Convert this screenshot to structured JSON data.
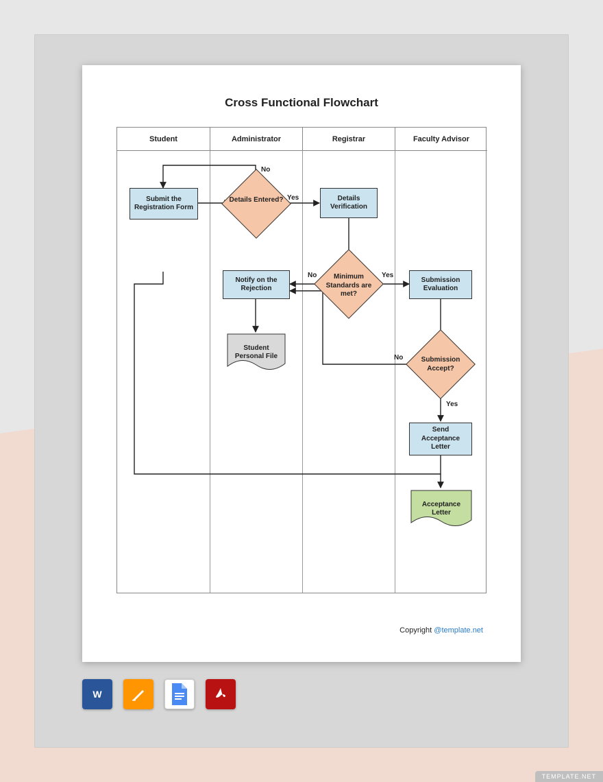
{
  "title": "Cross Functional Flowchart",
  "lanes": [
    "Student",
    "Administrator",
    "Registrar",
    "Faculty Advisor"
  ],
  "nodes": {
    "submit": "Submit the Registration Form",
    "detailsEntered": "Details Entered?",
    "detailsVerification": "Details Verification",
    "notifyRejection": "Notify on the Rejection",
    "minStandards": "Minimum Standards are met?",
    "submissionEval": "Submission Evaluation",
    "studentFile": "Student Personal File",
    "submissionAccept": "Submission Accept?",
    "sendAcceptance": "Send Acceptance Letter",
    "acceptanceLetter": "Acceptance Letter"
  },
  "edges": {
    "no": "No",
    "yes": "Yes"
  },
  "copyright": {
    "label": "Copyright",
    "link": "@template.net"
  },
  "watermark": "TEMPLATE.NET",
  "formats": [
    "Word",
    "Pages",
    "Google Docs",
    "PDF"
  ]
}
